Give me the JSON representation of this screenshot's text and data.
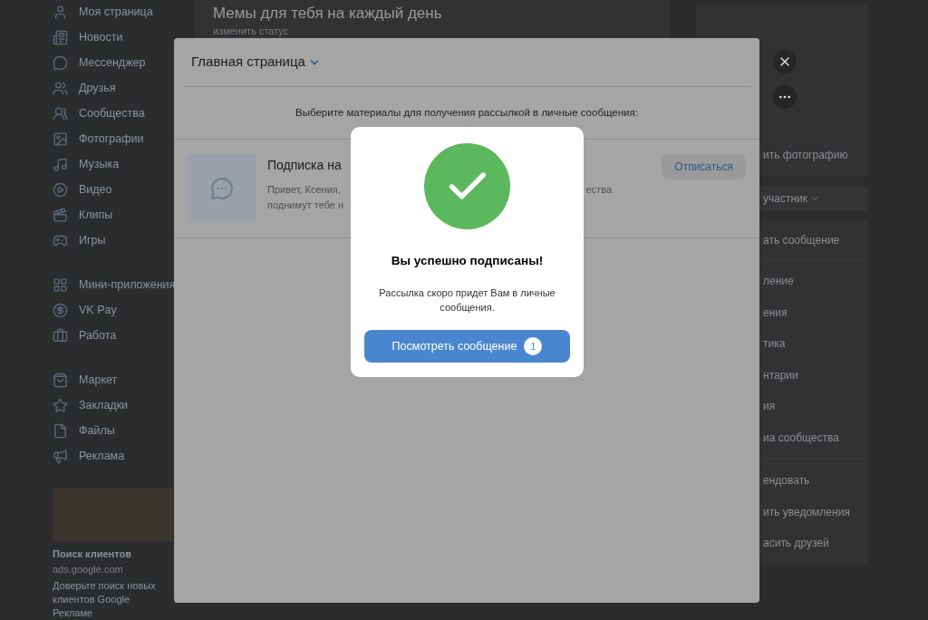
{
  "sidebar": {
    "groups": [
      [
        "Моя страница",
        "Новости",
        "Мессенджер",
        "Друзья",
        "Сообщества",
        "Фотографии",
        "Музыка",
        "Видео",
        "Клипы",
        "Игры"
      ],
      [
        "Мини-приложения",
        "VK Pay",
        "Работа"
      ],
      [
        "Маркет",
        "Закладки",
        "Файлы",
        "Реклама"
      ]
    ],
    "ad": {
      "title": "Поиск клиентов",
      "domain": "ads.google.com",
      "text": "Доверьте поиск новых клиентов Google Рекламе"
    }
  },
  "page": {
    "title": "Мемы для тебя на каждый день",
    "status": "изменить статус"
  },
  "right": {
    "photo_link": "ить фотографию",
    "member": "участник",
    "send": "ать сообщение",
    "menu_1": [
      "ление",
      "ения",
      "тика",
      "нтарии",
      "ия",
      "иа сообщества"
    ],
    "menu_2": [
      "ендовать",
      "ить уведомления",
      "асить друзей"
    ]
  },
  "modal": {
    "title": "Главная страница",
    "intro": "Выберите материалы для получения рассылкой в личные сообщения:",
    "item": {
      "title": "Подписка на",
      "text_left": "Привет, Ксения,",
      "text_right": "ества",
      "text_2": "поднимут тебе н",
      "button": "Отписаться"
    }
  },
  "success": {
    "title": "Вы успешно подписаны!",
    "text": "Рассылка скоро придет Вам в личные сообщения.",
    "button": "Посмотреть сообщение",
    "count": "1"
  }
}
